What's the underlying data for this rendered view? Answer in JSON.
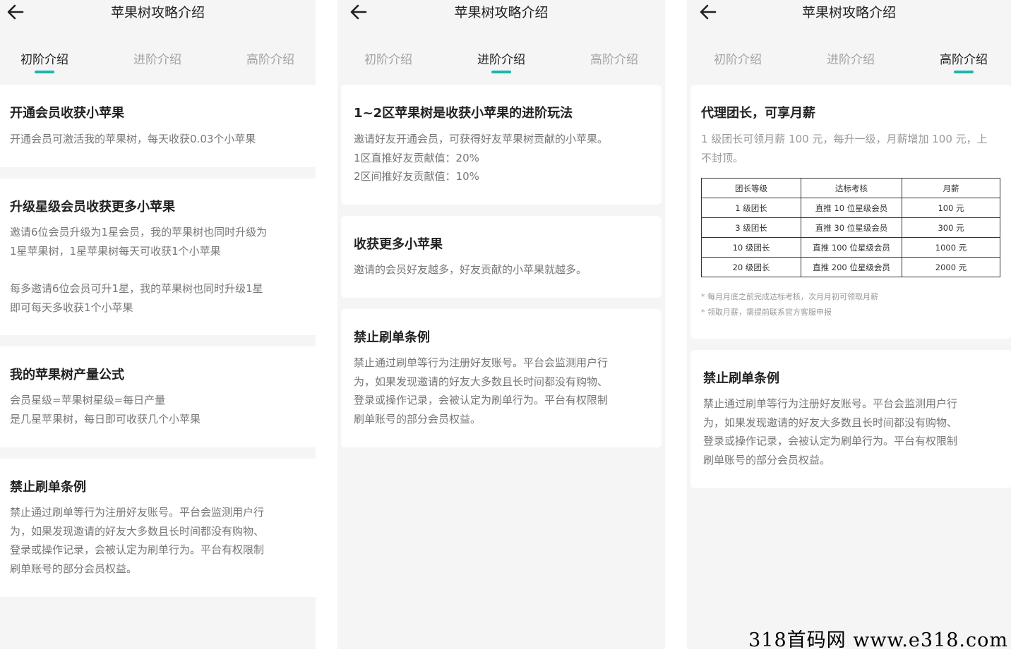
{
  "header": {
    "title": "苹果树攻略介绍"
  },
  "tabs": [
    "初阶介绍",
    "进阶介绍",
    "高阶介绍"
  ],
  "colors": {
    "accent": "#1cb5b0",
    "background": "#f5f5f5"
  },
  "screen1": {
    "cards": [
      {
        "title": "开通会员收获小苹果",
        "lines": [
          "开通会员可激活我的苹果树，每天收获0.03个小苹果"
        ]
      },
      {
        "title": "升级星级会员收获更多小苹果",
        "lines": [
          "邀请6位会员升级为1星会员，我的苹果树也同时升级为",
          "1星苹果树，1星苹果树每天可收获1个小苹果",
          "每多邀请6位会员可升1星，我的苹果树也同时升级1星",
          "即可每天多收获1个小苹果"
        ]
      },
      {
        "title": "我的苹果树产量公式",
        "lines": [
          "会员星级=苹果树星级=每日产量",
          "是几星苹果树，每日即可收获几个小苹果"
        ]
      },
      {
        "title": "禁止刷单条例",
        "lines": [
          "禁止通过刷单等行为注册好友账号。平台会监测用户行",
          "为，如果发现邀请的好友大多数且长时间都没有购物、",
          "登录或操作记录，会被认定为刷单行为。平台有权限制",
          "刷单账号的部分会员权益。"
        ]
      }
    ]
  },
  "screen2": {
    "cards": [
      {
        "title": "1~2区苹果树是收获小苹果的进阶玩法",
        "lines": [
          "邀请好友开通会员，可获得好友苹果树贡献的小苹果。",
          "1区直推好友贡献值：20%",
          "2区间推好友贡献值：10%"
        ]
      },
      {
        "title": "收获更多小苹果",
        "lines": [
          "邀请的会员好友越多，好友贡献的小苹果就越多。"
        ]
      },
      {
        "title": "禁止刷单条例",
        "lines": [
          "禁止通过刷单等行为注册好友账号。平台会监测用户行",
          "为，如果发现邀请的好友大多数且长时间都没有购物、",
          "登录或操作记录，会被认定为刷单行为。平台有权限制",
          "刷单账号的部分会员权益。"
        ]
      }
    ]
  },
  "screen3": {
    "card1": {
      "title": "代理团长，可享月薪",
      "lines": [
        "1 级团长可领月薪 100 元，每升一级，月薪增加 100 元，上",
        "不封顶。"
      ],
      "table": {
        "headers": [
          "团长等级",
          "达标考核",
          "月薪"
        ],
        "rows": [
          [
            "1 级团长",
            "直推 10 位星级会员",
            "100 元"
          ],
          [
            "3 级团长",
            "直推 30 位星级会员",
            "300 元"
          ],
          [
            "10 级团长",
            "直推 100 位星级会员",
            "1000 元"
          ],
          [
            "20 级团长",
            "直推 200 位星级会员",
            "2000 元"
          ]
        ]
      },
      "notes": [
        "* 每月月底之前完成达标考核，次月月初可领取月薪",
        "* 领取月薪，需提前联系官方客服申报"
      ]
    },
    "card2": {
      "title": "禁止刷单条例",
      "lines": [
        "禁止通过刷单等行为注册好友账号。平台会监测用户行",
        "为，如果发现邀请的好友大多数且长时间都没有购物、",
        "登录或操作记录，会被认定为刷单行为。平台有权限制",
        "刷单账号的部分会员权益。"
      ]
    }
  },
  "watermark": "318首码网 www.e318.com"
}
